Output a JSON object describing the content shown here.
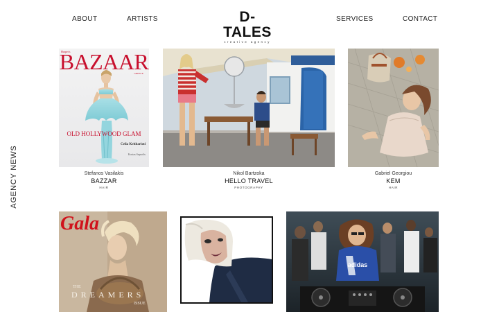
{
  "nav": {
    "about": "ABOUT",
    "artists": "ARTISTS",
    "services": "SERVICES",
    "contact": "CONTACT"
  },
  "logo": {
    "main": "D-TALES",
    "tagline": "creative agency"
  },
  "side_label": "AGENCY NEWS",
  "cards": [
    {
      "name": "Stefanos Vasilakis",
      "title": "BAZZAR",
      "role": "HAIR",
      "cover_masthead": "BAZAAR",
      "cover_brand": "Harper's",
      "cover_issue": "GREECE",
      "cover_headline": "OLD HOLLYWOOD GLAM",
      "cover_credit1": "Celia Kritharioti",
      "cover_credit2": "Kostas Sepsolis"
    },
    {
      "name": "Nikol Bartzoka",
      "title": "HELLO TRAVEL",
      "role": "PHOTOGRAPHY"
    },
    {
      "name": "Gabriel Georgiou",
      "title": "KEM",
      "role": "HAIR"
    },
    {
      "cover_masthead": "Gala",
      "cover_kicker": "THE",
      "cover_headline": "DREAMERS",
      "cover_issue": "ISSUE"
    },
    {},
    {
      "shirt_text": "adidas"
    }
  ],
  "colors": {
    "bazaar_red": "#c8102e",
    "gala_red": "#d0121b",
    "text": "#1a1a1a"
  }
}
